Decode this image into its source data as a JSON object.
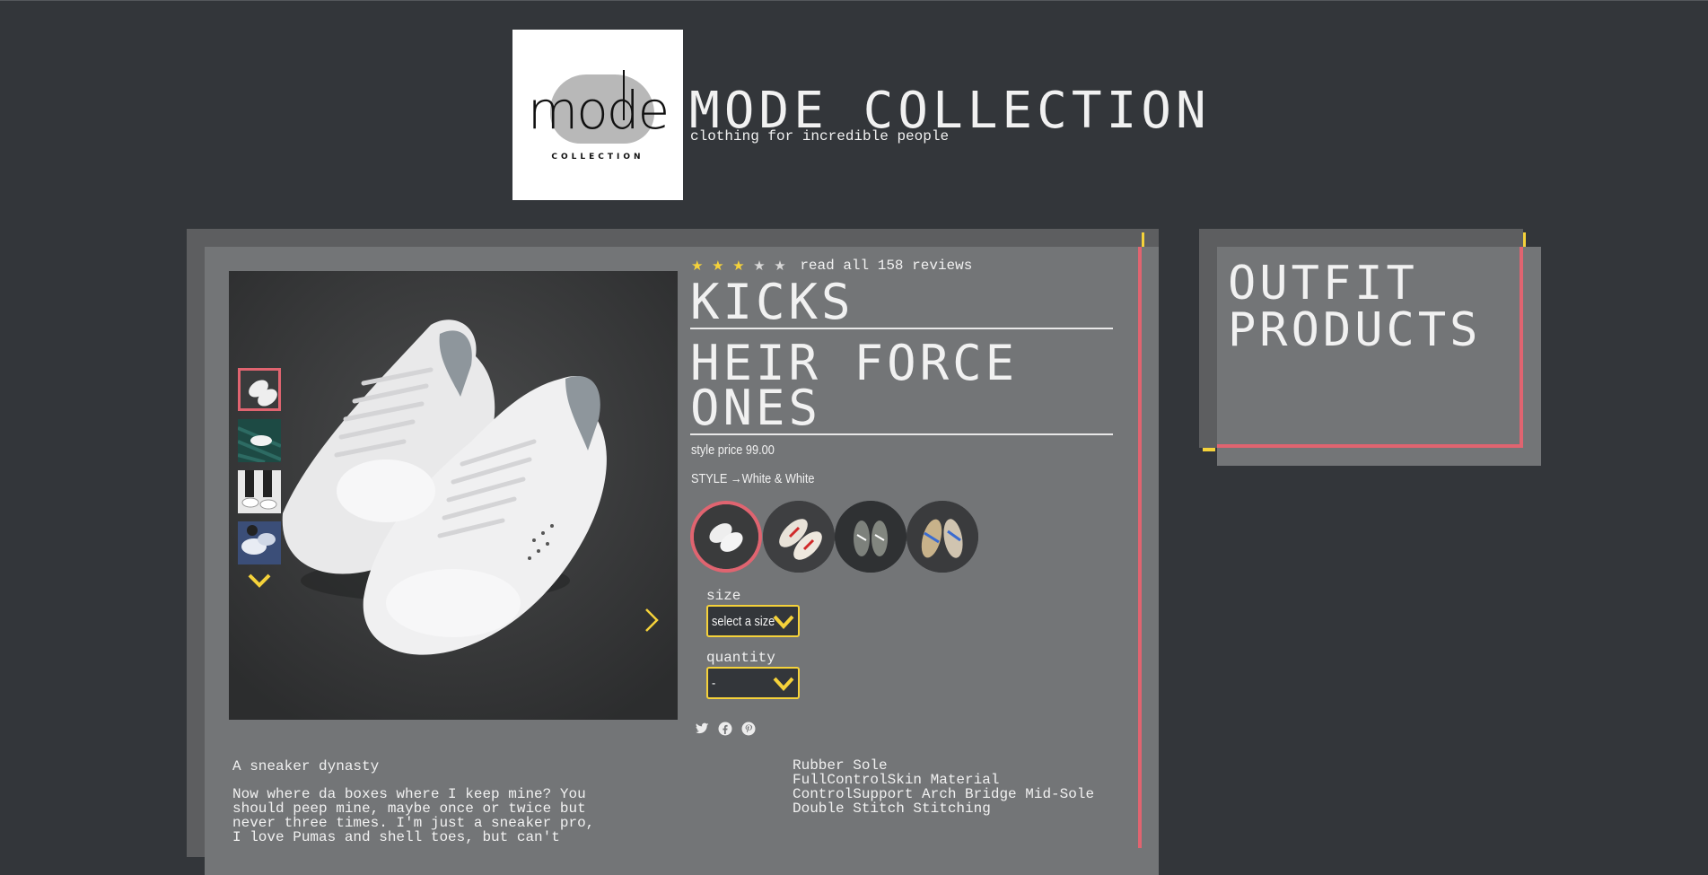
{
  "header": {
    "logo_word": "mode",
    "logo_sub": "COLLECTION",
    "brand_title": "MODE COLLECTION",
    "tagline": "clothing for incredible people"
  },
  "product": {
    "rating": 3,
    "rating_max": 5,
    "reviews_link": "read all 158 reviews",
    "category": "KICKS",
    "name_line1": "HEIR FORCE",
    "name_line2": "ONES",
    "price_text": "style price 99.00",
    "style_text": "STYLE →White & White",
    "size": {
      "label": "size",
      "value": "select a size"
    },
    "quantity": {
      "label": "quantity",
      "value": "-"
    },
    "description_title": "A sneaker dynasty",
    "description_line1": "Now where da boxes where I keep mine? You",
    "description_line2": "should peep mine, maybe once or twice but",
    "description_line3": "never three times. I'm just a sneaker pro,",
    "description_line4": "I love Pumas and shell toes, but can't",
    "features": [
      "Rubber Sole",
      "FullControlSkin Material",
      "ControlSupport Arch Bridge Mid-Sole",
      "Double Stitch Stitching"
    ]
  },
  "share_icons": [
    "twitter-icon",
    "facebook-icon",
    "pinterest-icon"
  ],
  "outfit": {
    "title_line1": "OUTFIT",
    "title_line2": "PRODUCTS"
  },
  "colors": {
    "accent_yellow": "#f5d23a",
    "accent_pink": "#e06470",
    "background": "#33363a",
    "card": "#737577"
  }
}
